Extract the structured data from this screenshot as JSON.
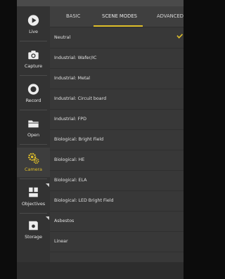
{
  "sidebar": {
    "items": [
      {
        "label": "Live",
        "icon": "play-icon"
      },
      {
        "label": "Capture",
        "icon": "camera-icon"
      },
      {
        "label": "Record",
        "icon": "record-icon"
      },
      {
        "label": "Open",
        "icon": "folder-icon"
      },
      {
        "label": "Camera",
        "icon": "gears-icon",
        "active": true
      },
      {
        "label": "Objectives",
        "icon": "objectives-icon"
      },
      {
        "label": "Storage",
        "icon": "storage-icon"
      }
    ]
  },
  "tabs": [
    {
      "label": "BASIC"
    },
    {
      "label": "SCENE MODES",
      "active": true
    },
    {
      "label": "ADVANCED"
    }
  ],
  "scene_modes": [
    {
      "label": "Neutral",
      "selected": true
    },
    {
      "label": "Industrial: Wafer/IC"
    },
    {
      "label": "Industrial: Metal"
    },
    {
      "label": "Industrial: Circuit board"
    },
    {
      "label": "Industrial: FPD"
    },
    {
      "label": "Biological: Bright Field"
    },
    {
      "label": "Biological: HE"
    },
    {
      "label": "Biological: ELA"
    },
    {
      "label": "Biological: LED Bright Field"
    },
    {
      "label": "Asbestos"
    },
    {
      "label": "Linear"
    }
  ],
  "colors": {
    "accent": "#e0bf2a",
    "sidebar_bg": "#333333",
    "panel_bg": "#383838",
    "text": "#e2e2e2"
  }
}
